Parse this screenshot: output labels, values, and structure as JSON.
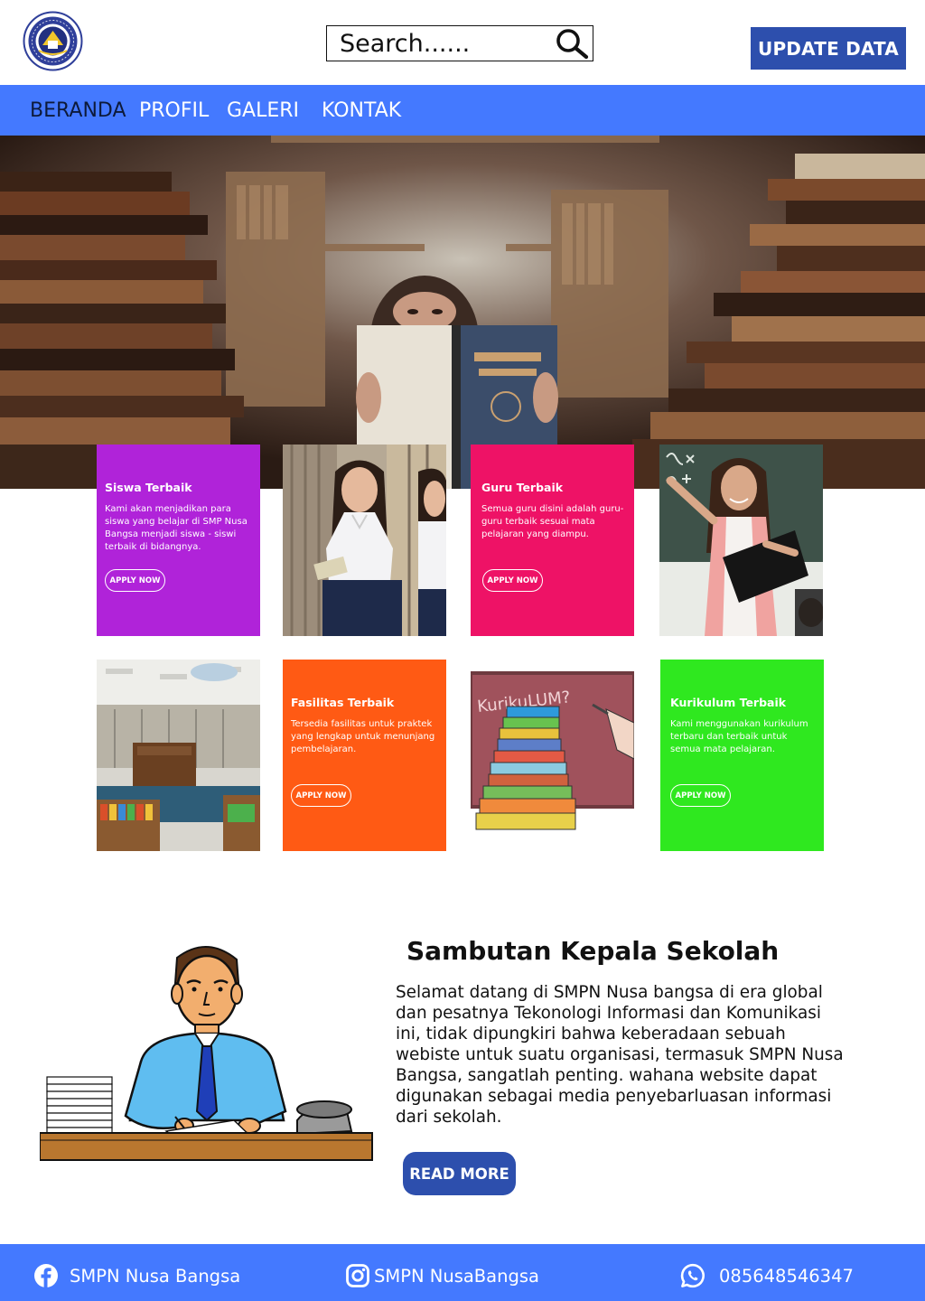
{
  "header": {
    "logo_icon": "school-emblem-icon",
    "search": {
      "placeholder": "Search......",
      "icon": "search-icon"
    },
    "update_button": "UPDATE DATA"
  },
  "nav": {
    "items": [
      {
        "label": "BERANDA",
        "active": true
      },
      {
        "label": "PROFIL",
        "active": false
      },
      {
        "label": "GALERI",
        "active": false
      },
      {
        "label": "KONTAK",
        "active": false
      }
    ]
  },
  "hero": {
    "image": "library-books-hero-photo"
  },
  "cards": [
    {
      "title": "Siswa Terbaik",
      "desc": "Kami akan menjadikan para siswa yang belajar di SMP Nusa Bangsa menjadi siswa - siswi terbaik di bidangnya.",
      "button": "APPLY NOW",
      "color": "#b023d9"
    },
    {
      "image": "students-photo"
    },
    {
      "title": "Guru Terbaik",
      "desc": "Semua guru disini adalah guru-guru terbaik sesuai mata pelajaran yang diampu.",
      "button": "APPLY NOW",
      "color": "#ee1266"
    },
    {
      "image": "teacher-photo"
    },
    {
      "image": "library-room-photo"
    },
    {
      "title": "Fasilitas Terbaik",
      "desc": "Tersedia fasilitas untuk praktek yang lengkap untuk menunjang pembelajaran.",
      "button": "APPLY NOW",
      "color": "#ff5a14"
    },
    {
      "image": "kurikulum-books-illustration",
      "board_text": "KurikuLUM?"
    },
    {
      "title": "Kurikulum Terbaik",
      "desc": "Kami menggunakan kurikulum terbaru dan terbaik untuk semua mata pelajaran.",
      "button": "APPLY NOW",
      "color": "#2fe81f"
    }
  ],
  "sambutan": {
    "title": "Sambutan Kepala Sekolah",
    "body": "Selamat datang  di SMPN Nusa bangsa  di era global dan pesatnya Tekonologi Informasi dan Komunikasi ini, tidak dipungkiri bahwa keberadaan sebuah webiste untuk suatu organisasi, termasuk SMPN Nusa Bangsa, sangatlah penting. wahana website dapat digunakan sebagai media penyebarluasan informasi dari sekolah.",
    "button": "READ MORE",
    "image": "principal-illustration"
  },
  "footer": {
    "facebook": {
      "icon": "facebook-icon",
      "text": "SMPN Nusa Bangsa"
    },
    "instagram": {
      "icon": "instagram-icon",
      "text": "SMPN NusaBangsa"
    },
    "whatsapp": {
      "icon": "whatsapp-icon",
      "text": "085648546347"
    }
  },
  "colors": {
    "nav_bg": "#4479ff",
    "button_bg": "#2d4fad",
    "card_purple": "#b023d9",
    "card_pink": "#ee1266",
    "card_orange": "#ff5a14",
    "card_green": "#2fe81f"
  }
}
